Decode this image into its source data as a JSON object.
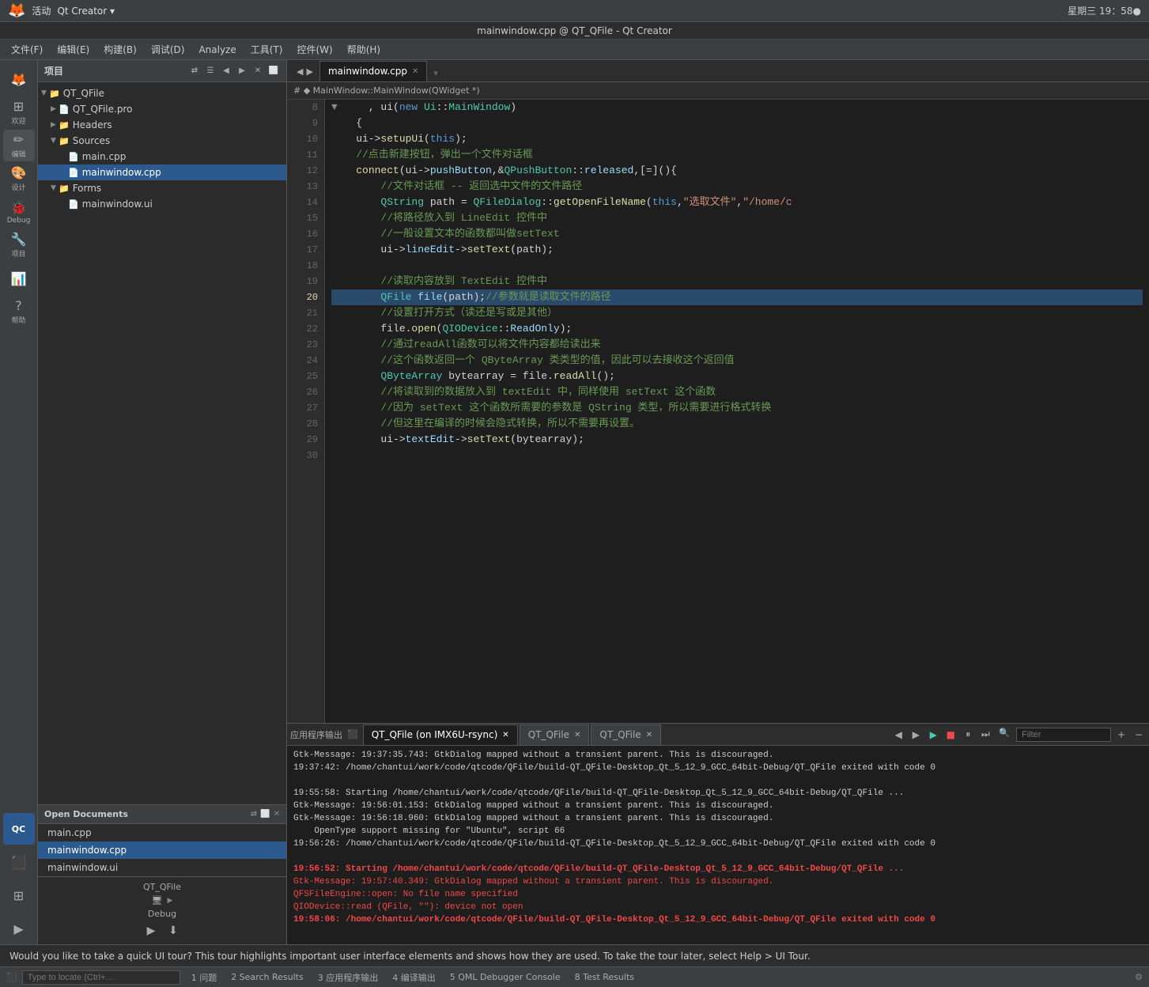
{
  "window": {
    "title": "星期三 19：58●",
    "app_title": "🦊 活动",
    "qt_title": "Qt Creator ▾",
    "full_title": "mainwindow.cpp @ QT_QFile - Qt Creator"
  },
  "menu": {
    "items": [
      "文件(F)",
      "编辑(E)",
      "构建(B)",
      "调试(D)",
      "Analyze",
      "工具(T)",
      "控件(W)",
      "帮助(H)"
    ]
  },
  "sidebar": {
    "icons": [
      {
        "name": "firefox-icon",
        "label": ""
      },
      {
        "name": "welcome-icon",
        "label": "欢迎"
      },
      {
        "name": "edit-icon",
        "label": "编辑"
      },
      {
        "name": "design-icon",
        "label": "设计"
      },
      {
        "name": "debug-icon",
        "label": "Debug"
      },
      {
        "name": "project-icon",
        "label": "项目"
      },
      {
        "name": "analyze-icon",
        "label": ""
      },
      {
        "name": "help-icon",
        "label": "帮助"
      },
      {
        "name": "qc-icon",
        "label": "QC"
      }
    ]
  },
  "project_panel": {
    "title": "项目",
    "tree": [
      {
        "id": "qt-qfile",
        "label": "QT_QFile",
        "level": 0,
        "expanded": true,
        "type": "project"
      },
      {
        "id": "qt-qfile-pro",
        "label": "QT_QFile.pro",
        "level": 1,
        "expanded": false,
        "type": "file"
      },
      {
        "id": "headers",
        "label": "Headers",
        "level": 1,
        "expanded": false,
        "type": "folder"
      },
      {
        "id": "sources",
        "label": "Sources",
        "level": 1,
        "expanded": true,
        "type": "folder"
      },
      {
        "id": "main-cpp",
        "label": "main.cpp",
        "level": 2,
        "expanded": false,
        "type": "file"
      },
      {
        "id": "mainwindow-cpp",
        "label": "mainwindow.cpp",
        "level": 2,
        "expanded": false,
        "type": "file",
        "selected": true
      },
      {
        "id": "forms",
        "label": "Forms",
        "level": 1,
        "expanded": true,
        "type": "folder"
      },
      {
        "id": "mainwindow-ui",
        "label": "mainwindow.ui",
        "level": 2,
        "expanded": false,
        "type": "file"
      }
    ]
  },
  "open_docs": {
    "title": "Open Documents",
    "items": [
      {
        "label": "main.cpp",
        "selected": false
      },
      {
        "label": "mainwindow.cpp",
        "selected": true
      },
      {
        "label": "mainwindow.ui",
        "selected": false
      }
    ]
  },
  "editor": {
    "tab_label": "mainwindow.cpp",
    "breadcrumb": "# ◆ MainWindow::MainWindow(QWidget *)",
    "lines": [
      {
        "num": 8,
        "tokens": [
          {
            "t": "    , ui(new Ui::MainWindow)",
            "c": "plain"
          }
        ]
      },
      {
        "num": 9,
        "tokens": [
          {
            "t": "{",
            "c": "plain"
          }
        ]
      },
      {
        "num": 10,
        "tokens": [
          {
            "t": "    ui->setupUi(this);",
            "c": "plain"
          }
        ]
      },
      {
        "num": 11,
        "tokens": [
          {
            "t": "    //点击新建按钮，弹出一个文件对话框",
            "c": "cmt"
          }
        ]
      },
      {
        "num": 12,
        "tokens": [
          {
            "t": "    connect(ui->pushButton,&QPushButton::released,[=](){",
            "c": "plain"
          }
        ]
      },
      {
        "num": 13,
        "tokens": [
          {
            "t": "        //文件对话框 -- 返回选中文件的文件路径",
            "c": "cmt"
          }
        ]
      },
      {
        "num": 14,
        "tokens": [
          {
            "t": "        QString path = QFileDialog::getOpenFileName(this,\"选取文件\",\"/home/c",
            "c": "plain"
          }
        ]
      },
      {
        "num": 15,
        "tokens": [
          {
            "t": "        //将路径放入到 LineEdit 控件中",
            "c": "cmt"
          }
        ]
      },
      {
        "num": 16,
        "tokens": [
          {
            "t": "        //一般设置文本的函数都叫做setText",
            "c": "cmt"
          }
        ]
      },
      {
        "num": 17,
        "tokens": [
          {
            "t": "        ui->lineEdit->setText(path);",
            "c": "plain"
          }
        ]
      },
      {
        "num": 18,
        "tokens": [
          {
            "t": "",
            "c": "plain"
          }
        ]
      },
      {
        "num": 19,
        "tokens": [
          {
            "t": "        //读取内容放到 TextEdit 控件中",
            "c": "cmt"
          }
        ]
      },
      {
        "num": 20,
        "tokens": [
          {
            "t": "        QFile file(path);//参数就是读取文件的路径",
            "c": "plain"
          }
        ],
        "highlighted": true
      },
      {
        "num": 21,
        "tokens": [
          {
            "t": "        //设置打开方式（读还是写或是其他）",
            "c": "cmt"
          }
        ]
      },
      {
        "num": 22,
        "tokens": [
          {
            "t": "        file.open(QIODevice::ReadOnly);",
            "c": "plain"
          }
        ]
      },
      {
        "num": 23,
        "tokens": [
          {
            "t": "        //通过readAll函数可以将文件内容都给读出来",
            "c": "cmt"
          }
        ]
      },
      {
        "num": 24,
        "tokens": [
          {
            "t": "        //这个函数返回一个 QByteArray 类类型的值，因此可以去接收这个返回值",
            "c": "cmt"
          }
        ]
      },
      {
        "num": 25,
        "tokens": [
          {
            "t": "        QByteArray bytearray = file.readAll();",
            "c": "plain"
          }
        ]
      },
      {
        "num": 26,
        "tokens": [
          {
            "t": "        //将读取到的数据放入到 textEdit 中，同样使用 setText 这个函数",
            "c": "cmt"
          }
        ]
      },
      {
        "num": 27,
        "tokens": [
          {
            "t": "        //因为 setText 这个函数所需要的参数是 QString 类型，所以需要进行格式转换",
            "c": "cmt"
          }
        ]
      },
      {
        "num": 28,
        "tokens": [
          {
            "t": "        //但这里在编译的时候会隐式转换，所以不需要再设置。",
            "c": "cmt"
          }
        ]
      },
      {
        "num": 29,
        "tokens": [
          {
            "t": "        ui->textEdit->setText(bytearray);",
            "c": "plain"
          }
        ]
      },
      {
        "num": 30,
        "tokens": [
          {
            "t": "",
            "c": "plain"
          }
        ]
      }
    ]
  },
  "output_panel": {
    "title": "应用程序输出",
    "tabs": [
      {
        "label": "QT_QFile (on IMX6U-rsync)",
        "closable": true
      },
      {
        "label": "QT_QFile",
        "closable": true
      },
      {
        "label": "QT_QFile",
        "closable": true
      }
    ],
    "filter_placeholder": "Filter",
    "lines": [
      {
        "text": "Gtk-Message: 19:37:35.743: GtkDialog mapped without a transient parent. This is discouraged.",
        "type": "normal"
      },
      {
        "text": "19:37:42: /home/chantui/work/code/qtcode/QFile/build-QT_QFile-Desktop_Qt_5_12_9_GCC_64bit-Debug/QT_QFile exited with code 0",
        "type": "normal"
      },
      {
        "text": "",
        "type": "normal"
      },
      {
        "text": "19:55:58: Starting /home/chantui/work/code/qtcode/QFile/build-QT_QFile-Desktop_Qt_5_12_9_GCC_64bit-Debug/QT_QFile ...",
        "type": "normal"
      },
      {
        "text": "Gtk-Message: 19:56:01.153: GtkDialog mapped without a transient parent. This is discouraged.",
        "type": "normal"
      },
      {
        "text": "Gtk-Message: 19:56:18.960: GtkDialog mapped without a transient parent. This is discouraged.",
        "type": "normal"
      },
      {
        "text": "    OpenType support missing for \"Ubuntu\", script 66",
        "type": "normal"
      },
      {
        "text": "19:56:26: /home/chantui/work/code/qtcode/QFile/build-QT_QFile-Desktop_Qt_5_12_9_GCC_64bit-Debug/QT_QFile exited with code 0",
        "type": "normal"
      },
      {
        "text": "",
        "type": "normal"
      },
      {
        "text": "19:56:52: Starting /home/chantui/work/code/qtcode/QFile/build-QT_QFile-Desktop_Qt_5_12_9_GCC_64bit-Debug/QT_QFile ...",
        "type": "bold_err"
      },
      {
        "text": "Gtk-Message: 19:57:40.349: GtkDialog mapped without a transient parent. This is discouraged.",
        "type": "err"
      },
      {
        "text": "QFSFileEngine::open: No file name specified",
        "type": "err"
      },
      {
        "text": "QIODevice::read (QFile, \"\"): device not open",
        "type": "err"
      },
      {
        "text": "19:58:06: /home/chantui/work/code/qtcode/QFile/build-QT_QFile-Desktop_Qt_5_12_9_GCC_64bit-Debug/QT_QFile exited with code 0",
        "type": "bold_err"
      }
    ]
  },
  "notification": {
    "text": "Would you like to take a quick UI tour? This tour highlights important user interface elements and shows how they are used. To take the tour later, select Help > UI Tour."
  },
  "bottom_tabs": {
    "items": [
      {
        "num": "1",
        "label": "问题"
      },
      {
        "num": "2",
        "label": "Search Results"
      },
      {
        "num": "3",
        "label": "应用程序输出"
      },
      {
        "num": "4",
        "label": "编译输出"
      },
      {
        "num": "5",
        "label": "QML Debugger Console"
      },
      {
        "num": "8",
        "label": "Test Results"
      }
    ]
  },
  "status_bar": {
    "project": "QT_QFile",
    "mode": "Debug",
    "search_placeholder": "Type to locate (Ctrl+..."
  },
  "debug_panel": {
    "project_name": "QT_QFile",
    "mode": "Debug"
  }
}
